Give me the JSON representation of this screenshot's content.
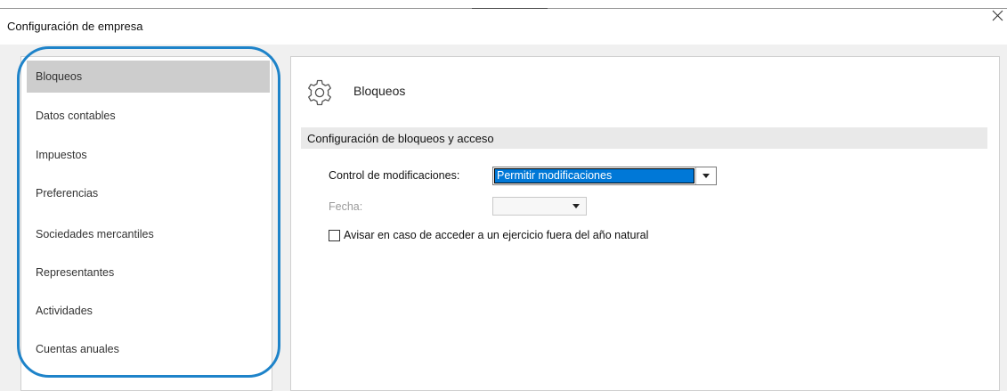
{
  "window": {
    "title": "Configuración de empresa",
    "close_icon": "close-icon"
  },
  "sidebar": {
    "items": [
      {
        "label": "Bloqueos",
        "active": true
      },
      {
        "label": "Datos contables",
        "active": false
      },
      {
        "label": "Impuestos",
        "active": false
      },
      {
        "label": "Preferencias",
        "active": false
      },
      {
        "label": "Sociedades mercantiles",
        "active": false
      },
      {
        "label": "Representantes",
        "active": false
      },
      {
        "label": "Actividades",
        "active": false
      },
      {
        "label": "Cuentas anuales",
        "active": false
      }
    ],
    "highlight_color": "#1e83c9"
  },
  "panel": {
    "icon": "gear-icon",
    "title": "Bloqueos",
    "section_title": "Configuración de bloqueos y acceso",
    "control_label": "Control de modificaciones:",
    "control_value": "Permitir modificaciones",
    "fecha_label": "Fecha:",
    "fecha_value": "",
    "checkbox_label": "Avisar en caso de acceder a un ejercicio fuera del año natural",
    "checkbox_checked": false
  },
  "colors": {
    "selection": "#0078d7",
    "active_item": "#cdcdcd",
    "background": "#f0f0f0"
  }
}
